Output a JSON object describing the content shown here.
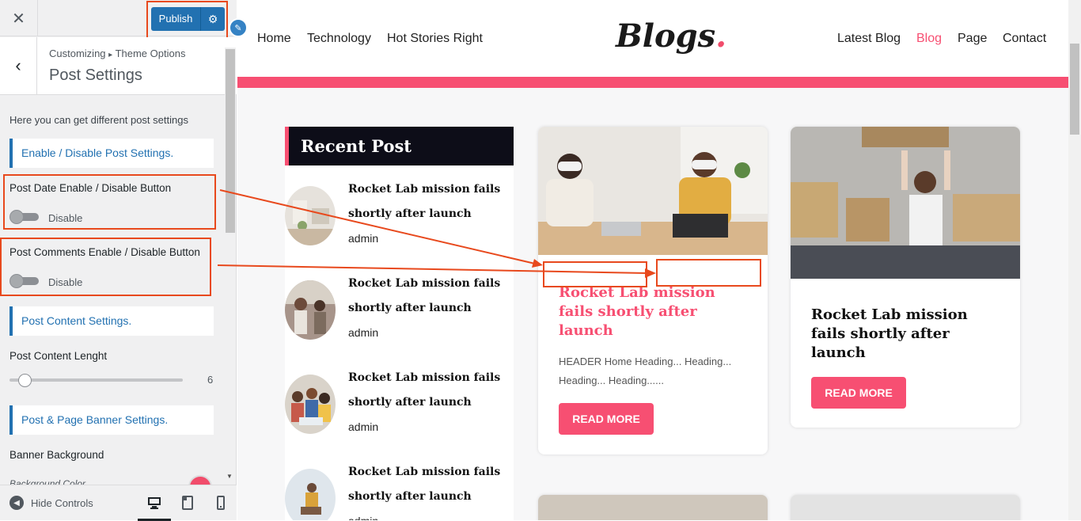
{
  "sidebar": {
    "close_icon": "close-icon",
    "publish_label": "Publish",
    "breadcrumb_part1": "Customizing",
    "breadcrumb_sep": "▸",
    "breadcrumb_part2": "Theme Options",
    "title": "Post Settings",
    "description": "Here you can get different post settings",
    "sections": {
      "enable_disable": "Enable / Disable Post Settings.",
      "content": "Post Content Settings.",
      "banner": "Post & Page Banner Settings."
    },
    "post_date": {
      "label": "Post Date Enable / Disable Button",
      "state": "Disable"
    },
    "post_comments": {
      "label": "Post Comments Enable / Disable Button",
      "state": "Disable"
    },
    "content_length": {
      "label": "Post Content Lenght",
      "value": "6"
    },
    "banner_background": "Banner Background",
    "background_color_label": "Background Color",
    "background_color": "#f14c6b",
    "hide_controls": "Hide Controls",
    "annotation_color": "#e8491d"
  },
  "site": {
    "nav_left": [
      "Home",
      "Technology",
      "Hot Stories Right"
    ],
    "logo": "Blogs",
    "logo_dot": ".",
    "nav_right": [
      "Latest Blog",
      "Blog",
      "Page",
      "Contact"
    ],
    "active_nav": "Blog",
    "accent": "#f74f72",
    "recent": {
      "heading": "Recent Post",
      "items": [
        {
          "title": "Rocket Lab mission fails shortly after launch",
          "author": "admin"
        },
        {
          "title": "Rocket Lab mission fails shortly after launch",
          "author": "admin"
        },
        {
          "title": "Rocket Lab mission fails shortly after launch",
          "author": "admin"
        },
        {
          "title": "Rocket Lab mission fails shortly after launch",
          "author": "admin"
        }
      ]
    },
    "cards": [
      {
        "title": "Rocket Lab mission fails shortly after launch",
        "excerpt": "HEADER Home Heading... Heading... Heading... Heading......",
        "button": "READ MORE"
      },
      {
        "title": "Rocket Lab mission fails shortly after launch",
        "button": "READ MORE"
      }
    ]
  }
}
